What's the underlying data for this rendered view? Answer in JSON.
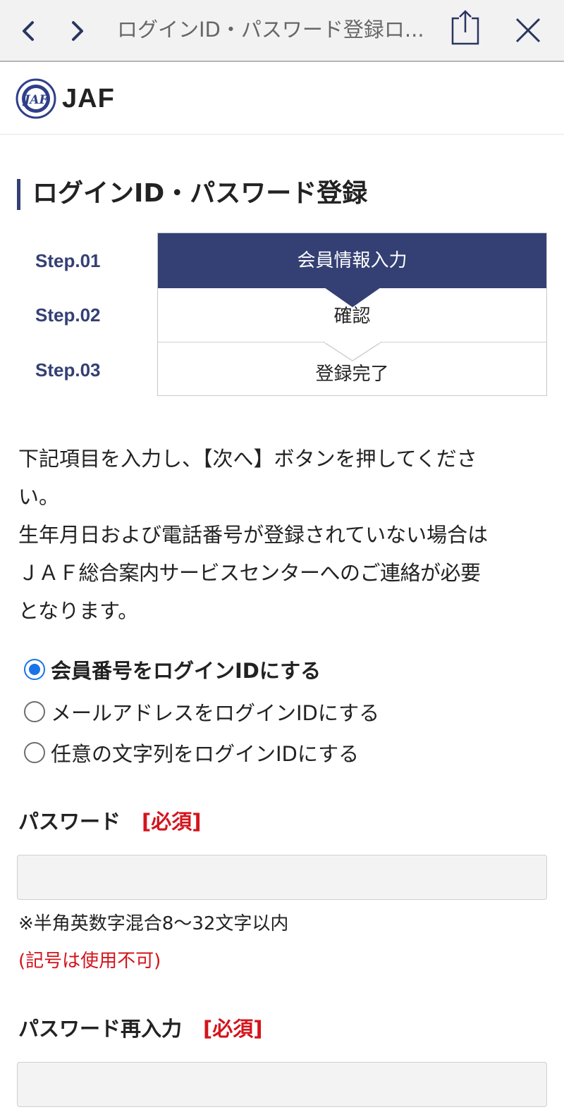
{
  "browser": {
    "title": "ログインID・パスワード登録ロ..."
  },
  "site": {
    "logo_text": "JAF",
    "logo_emblem_text": "JAF"
  },
  "page": {
    "title": "ログインID・パスワード登録"
  },
  "steps": [
    {
      "label": "Step.01",
      "name": "会員情報入力",
      "active": true
    },
    {
      "label": "Step.02",
      "name": "確認",
      "active": false
    },
    {
      "label": "Step.03",
      "name": "登録完了",
      "active": false
    }
  ],
  "instructions": {
    "line1": "下記項目を入力し、【次へ】ボタンを押してくださ",
    "line2": "い。",
    "line3": "生年月日および電話番号が登録されていない場合は",
    "line4": "ＪＡＦ総合案内サービスセンターへのご連絡が必要",
    "line5": "となります。"
  },
  "login_id_options": [
    {
      "label": "会員番号をログインIDにする",
      "selected": true
    },
    {
      "label": "メールアドレスをログインIDにする",
      "selected": false
    },
    {
      "label": "任意の文字列をログインIDにする",
      "selected": false
    }
  ],
  "password": {
    "label": "パスワード",
    "required": "[必須]",
    "value": "",
    "note": "※半角英数字混合8〜32文字以内",
    "note_red": "(記号は使用不可)"
  },
  "password_confirm": {
    "label": "パスワード再入力",
    "required": "[必須]",
    "value": ""
  },
  "colors": {
    "navy": "#344074",
    "required_red": "#d4141c",
    "radio_blue": "#1a73e8"
  },
  "icons": {
    "back": "chevron-left-icon",
    "forward": "chevron-right-icon",
    "share": "share-icon",
    "close": "close-icon"
  }
}
